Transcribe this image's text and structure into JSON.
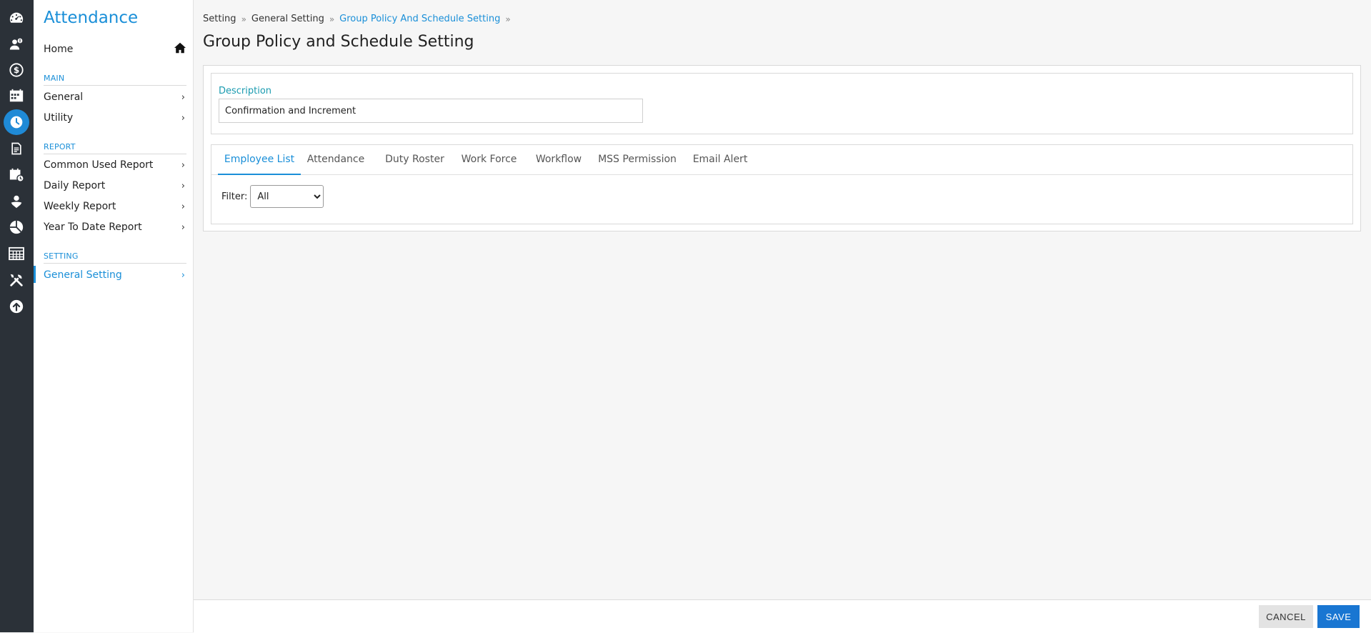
{
  "rail": {
    "items": [
      {
        "icon": "dashboard-icon"
      },
      {
        "icon": "employee-icon"
      },
      {
        "icon": "payroll-icon"
      },
      {
        "icon": "calendar-icon"
      },
      {
        "icon": "attendance-clock-icon",
        "active": true
      },
      {
        "icon": "document-icon"
      },
      {
        "icon": "leave-calendar-icon"
      },
      {
        "icon": "people-icon"
      },
      {
        "icon": "analytics-icon"
      },
      {
        "icon": "table-icon"
      },
      {
        "icon": "tools-icon"
      },
      {
        "icon": "upload-icon"
      }
    ]
  },
  "sidebar": {
    "title": "Attendance",
    "home_label": "Home",
    "sections": {
      "main": "MAIN",
      "report": "REPORT",
      "setting": "SETTING"
    },
    "items": {
      "general": "General",
      "utility": "Utility",
      "common_used_report": "Common Used Report",
      "daily_report": "Daily Report",
      "weekly_report": "Weekly Report",
      "year_to_date_report": "Year To Date Report",
      "general_setting": "General Setting"
    },
    "chevron": "›",
    "accent_color": "#1a8fd8"
  },
  "breadcrumb": {
    "items": [
      "Setting",
      "General Setting",
      "Group Policy And Schedule Setting"
    ],
    "separator": "»"
  },
  "page": {
    "title": "Group Policy and Schedule Setting"
  },
  "description": {
    "label": "Description",
    "value": "Confirmation and Increment"
  },
  "tabs": {
    "items": [
      "Employee List",
      "Attendance",
      "Duty Roster",
      "Work Force",
      "Workflow",
      "MSS Permission",
      "Email Alert"
    ],
    "active": "Employee List"
  },
  "filter": {
    "label": "Filter:",
    "selected": "All"
  },
  "footer": {
    "cancel_label": "CANCEL",
    "save_label": "SAVE",
    "save_color": "#1976d2"
  }
}
